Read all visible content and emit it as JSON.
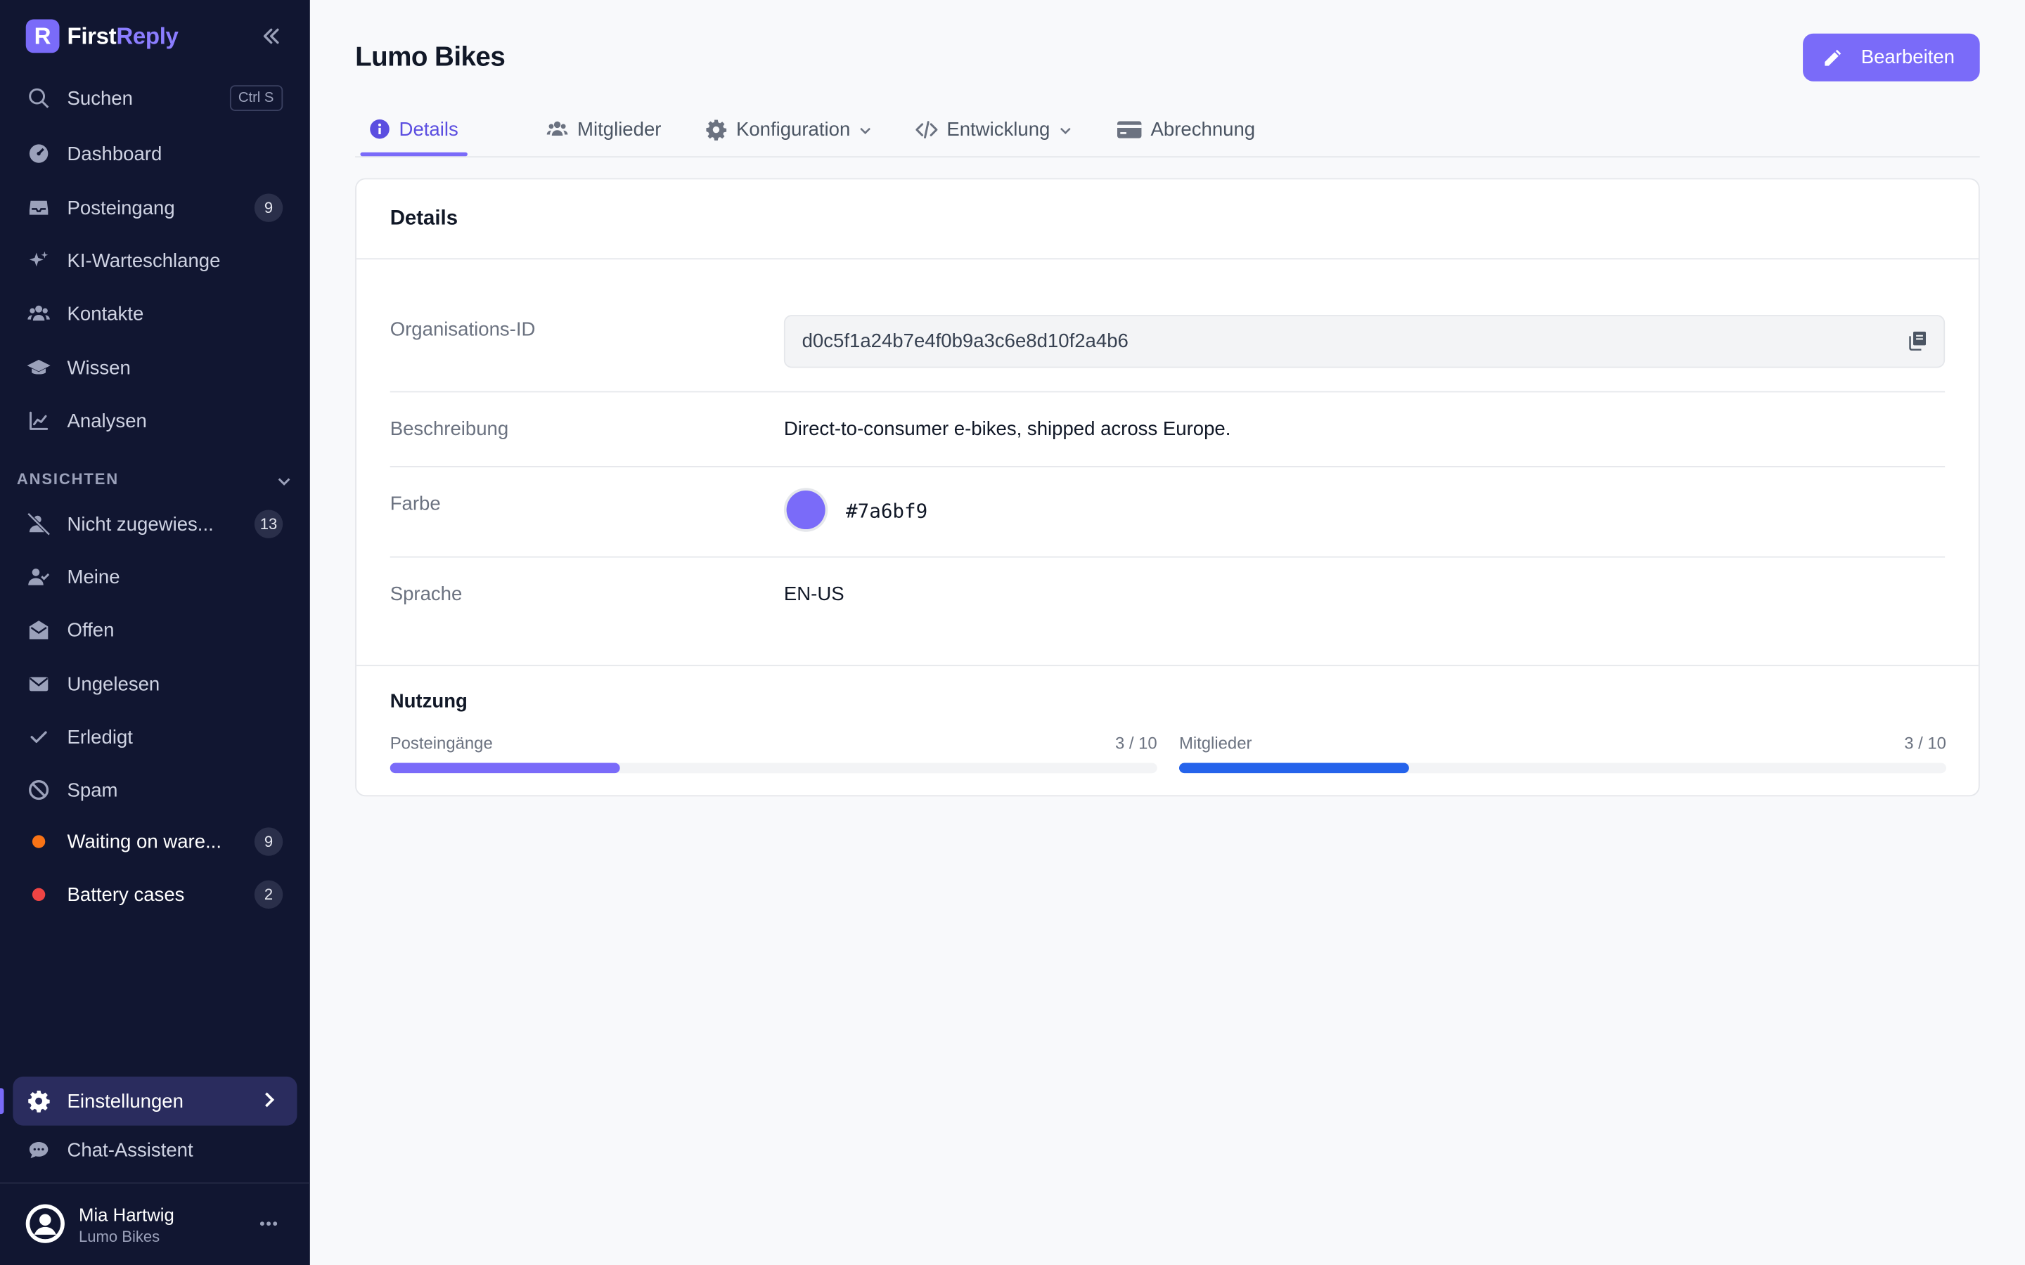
{
  "app": {
    "brand_first": "First",
    "brand_second": "Reply",
    "logo_letter": "R",
    "accent_color": "#7a6bf9"
  },
  "sidebar": {
    "search": {
      "label": "Suchen",
      "shortcut": "Ctrl S"
    },
    "items": [
      {
        "label": "Dashboard",
        "icon": "dashboard-icon"
      },
      {
        "label": "Posteingang",
        "icon": "inbox-icon",
        "badge": "9"
      },
      {
        "label": "KI-Warteschlange",
        "icon": "sparkles-icon"
      },
      {
        "label": "Kontakte",
        "icon": "users-icon"
      },
      {
        "label": "Wissen",
        "icon": "graduation-cap-icon"
      },
      {
        "label": "Analysen",
        "icon": "chart-line-icon"
      }
    ],
    "views_title": "ANSICHTEN",
    "views": [
      {
        "label": "Nicht zugewies...",
        "icon": "user-slash-icon",
        "badge": "13"
      },
      {
        "label": "Meine",
        "icon": "user-check-icon"
      },
      {
        "label": "Offen",
        "icon": "envelope-open-icon"
      },
      {
        "label": "Ungelesen",
        "icon": "envelope-icon"
      },
      {
        "label": "Erledigt",
        "icon": "check-icon"
      },
      {
        "label": "Spam",
        "icon": "ban-icon"
      },
      {
        "label": "Waiting on ware...",
        "dot_color": "#f97316",
        "badge": "9"
      },
      {
        "label": "Battery cases",
        "dot_color": "#ef4444",
        "badge": "2"
      }
    ],
    "settings_label": "Einstellungen",
    "assistant_label": "Chat-Assistent",
    "user": {
      "name": "Mia Hartwig",
      "org": "Lumo Bikes"
    }
  },
  "main": {
    "title": "Lumo Bikes",
    "edit_label": "Bearbeiten",
    "tabs": [
      {
        "label": "Details",
        "icon": "info-circle-icon",
        "active": true
      },
      {
        "label": "Mitglieder",
        "icon": "users-icon"
      },
      {
        "label": "Konfiguration",
        "icon": "gear-icon",
        "dropdown": true
      },
      {
        "label": "Entwicklung",
        "icon": "code-icon",
        "dropdown": true
      },
      {
        "label": "Abrechnung",
        "icon": "credit-card-icon"
      }
    ],
    "details": {
      "heading": "Details",
      "org_id_label": "Organisations-ID",
      "org_id": "d0c5f1a24b7e4f0b9a3c6e8d10f2a4b6",
      "description_label": "Beschreibung",
      "description": "Direct-to-consumer e-bikes, shipped across Europe.",
      "color_label": "Farbe",
      "color": "#7a6bf9",
      "color_text": "#7a6bf9",
      "language_label": "Sprache",
      "language": "EN-US"
    },
    "usage": {
      "heading": "Nutzung",
      "meters": [
        {
          "label": "Posteingänge",
          "value_text": "3 / 10",
          "fraction": 0.3,
          "color": "#7a6bf9"
        },
        {
          "label": "Mitglieder",
          "value_text": "3 / 10",
          "fraction": 0.3,
          "color": "#2563eb"
        }
      ]
    }
  }
}
